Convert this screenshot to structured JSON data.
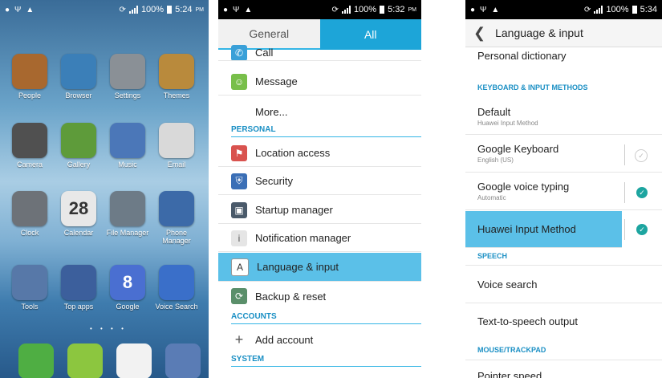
{
  "home": {
    "status": {
      "battery": "100%",
      "time": "5:24",
      "ampm": "PM"
    },
    "apps": [
      {
        "label": "People",
        "icon": "people-icon",
        "color": "#a8682f"
      },
      {
        "label": "Browser",
        "icon": "globe-icon",
        "color": "#3b7fb8"
      },
      {
        "label": "Settings",
        "icon": "gear-icon",
        "color": "#8a9096"
      },
      {
        "label": "Themes",
        "icon": "paint-icon",
        "color": "#b98a3c"
      },
      {
        "label": "Camera",
        "icon": "camera-icon",
        "color": "#505050"
      },
      {
        "label": "Gallery",
        "icon": "landscape-icon",
        "color": "#5e9b3a"
      },
      {
        "label": "Music",
        "icon": "music-icon",
        "color": "#4b77b8"
      },
      {
        "label": "Email",
        "icon": "envelope-icon",
        "color": "#d9d9d9"
      },
      {
        "label": "Clock",
        "icon": "clock-icon",
        "color": "#6d7278"
      },
      {
        "label": "Calendar",
        "icon": "calendar-icon",
        "color": "#e8e8e8",
        "text": "28"
      },
      {
        "label": "File Manager",
        "icon": "folder-icon",
        "color": "#6d7b87"
      },
      {
        "label": "Phone Manager",
        "icon": "shield-icon",
        "color": "#3c6aa8"
      },
      {
        "label": "Tools",
        "icon": "tools-icon",
        "color": "#5778a8"
      },
      {
        "label": "Top apps",
        "icon": "apps-icon",
        "color": "#3c5f9c"
      },
      {
        "label": "Google",
        "icon": "google-icon",
        "color": "#4a6fd1",
        "text": "8"
      },
      {
        "label": "Voice Search",
        "icon": "mic-icon",
        "color": "#3a6fc9"
      }
    ],
    "dock": [
      {
        "icon": "phone-icon",
        "color": "#4fae43"
      },
      {
        "icon": "chat-icon",
        "color": "#8cc63f"
      },
      {
        "icon": "play-store-icon",
        "color": "#f2f2f2"
      },
      {
        "icon": "apps-grid-icon",
        "color": "#5a7cb5"
      }
    ]
  },
  "settings": {
    "status": {
      "battery": "100%",
      "time": "5:32",
      "ampm": "PM"
    },
    "tabs": {
      "general": "General",
      "all": "All"
    },
    "rows": {
      "call": "Call",
      "message": "Message",
      "more": "More...",
      "location": "Location access",
      "security": "Security",
      "startup": "Startup manager",
      "notification": "Notification manager",
      "language": "Language & input",
      "backup": "Backup & reset",
      "add_account": "Add account"
    },
    "sections": {
      "personal": "PERSONAL",
      "accounts": "ACCOUNTS",
      "system": "SYSTEM"
    }
  },
  "language": {
    "status": {
      "battery": "100%",
      "time": "5:34"
    },
    "title": "Language & input",
    "personal_dictionary": "Personal dictionary",
    "section_keyboard": "KEYBOARD & INPUT METHODS",
    "default": {
      "title": "Default",
      "sub": "Huawei Input Method"
    },
    "google_keyboard": {
      "title": "Google Keyboard",
      "sub": "English (US)"
    },
    "google_voice": {
      "title": "Google voice typing",
      "sub": "Automatic"
    },
    "huawei": {
      "title": "Huawei Input Method"
    },
    "section_speech": "SPEECH",
    "voice_search": "Voice search",
    "tts": "Text-to-speech output",
    "section_mouse": "MOUSE/TRACKPAD",
    "pointer": "Pointer speed"
  }
}
